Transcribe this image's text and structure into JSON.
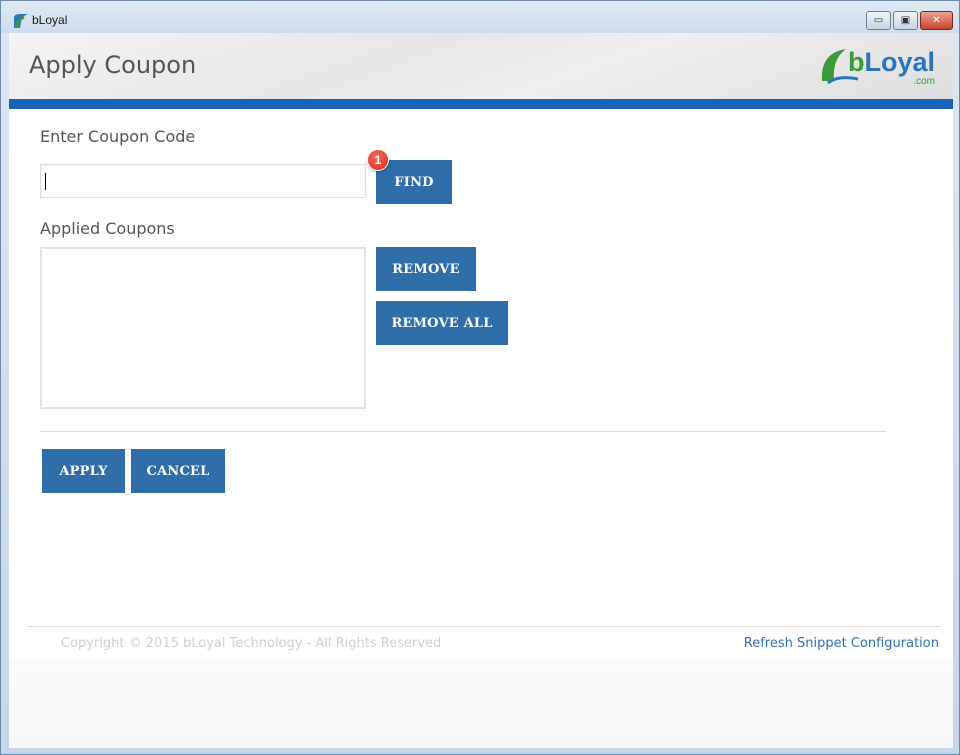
{
  "window": {
    "title": "bLoyal",
    "minimize_glyph": "▭",
    "maximize_glyph": "▣",
    "close_glyph": "✕"
  },
  "header": {
    "title": "Apply Coupon",
    "logo_text_b": "b",
    "logo_text_rest": "Loyal",
    "logo_com": ".com"
  },
  "coupon": {
    "enter_label": "Enter Coupon Code",
    "input_value": "",
    "find_label": "FIND",
    "badge_count": "1"
  },
  "applied": {
    "label": "Applied Coupons",
    "items": [],
    "remove_label": "REMOVE",
    "remove_all_label": "REMOVE ALL"
  },
  "actions": {
    "apply_label": "APPLY",
    "cancel_label": "CANCEL"
  },
  "footer": {
    "copyright": "Copyright © 2015 bLoyal Technology - All Rights Reserved",
    "refresh_link": "Refresh Snippet Configuration"
  },
  "colors": {
    "accent_bar": "#1b63b8",
    "button": "#2f6ea9",
    "link": "#2f6fb0",
    "badge": "#d92d1c"
  }
}
